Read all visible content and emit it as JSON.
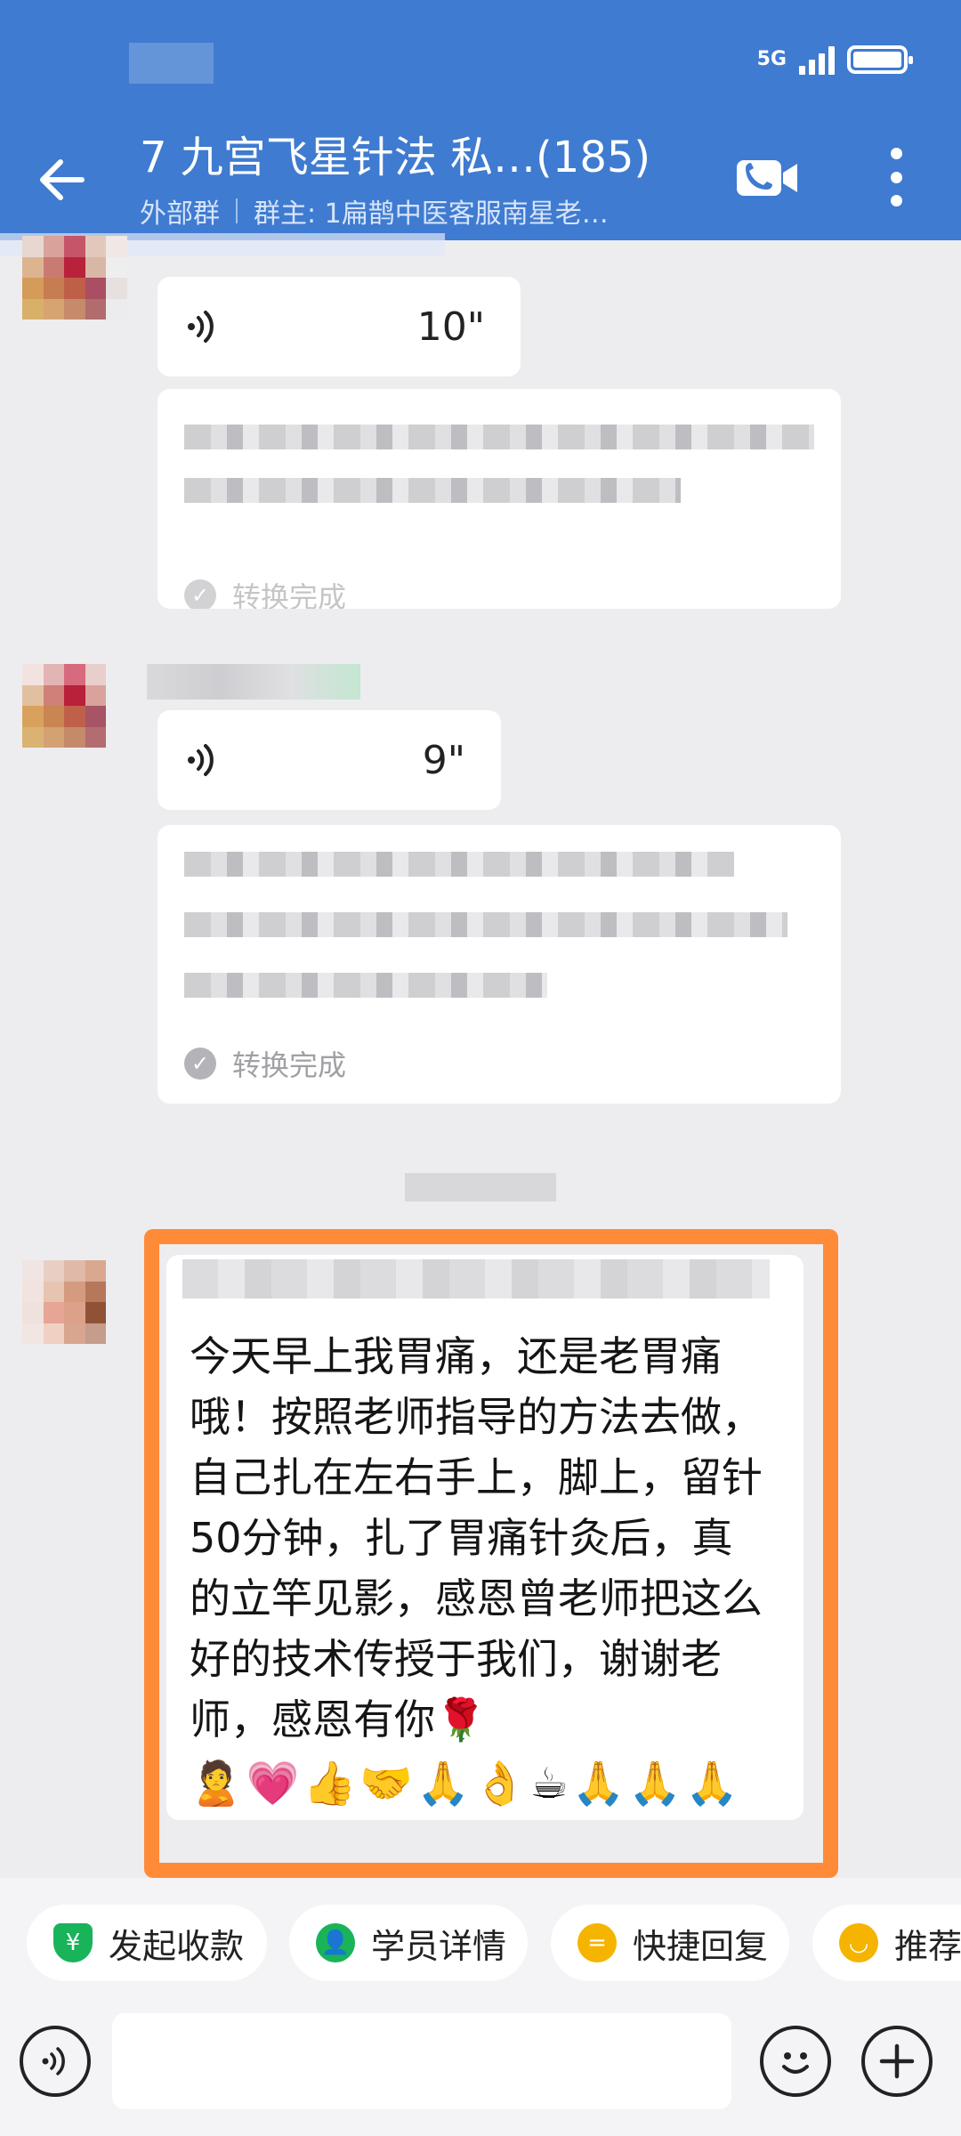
{
  "status_bar": {
    "signal": "5G"
  },
  "header": {
    "title": "7  九宫飞星针法 私…(185)",
    "group_type": "外部群",
    "owner": "群主: 1扁鹊中医客服南星老…"
  },
  "messages": [
    {
      "type": "voice",
      "duration": "10\"",
      "transcription_status": "转换完成"
    },
    {
      "type": "voice",
      "duration": "9\"",
      "transcription_status": "转换完成"
    },
    {
      "type": "text",
      "text": "今天早上我胃痛，还是老胃痛哦！按照老师指导的方法去做，自己扎在左右手上，脚上，留针50分钟，扎了胃痛针灸后，真的立竿见影，感恩曾老师把这么好的技术传授于我们，谢谢老师，感恩有你🌹",
      "emojis": "🙎💗👍🤝🙏👌☕🙏🙏🙏"
    }
  ],
  "quick_actions": [
    {
      "label": "发起收款",
      "icon": "yuan-shield-icon",
      "color": "#19b35a"
    },
    {
      "label": "学员详情",
      "icon": "person-list-icon",
      "color": "#19b35a"
    },
    {
      "label": "快捷回复",
      "icon": "quick-reply-icon",
      "color": "#f5b400"
    },
    {
      "label": "推荐",
      "icon": "recommend-icon",
      "color": "#f5b400"
    }
  ],
  "input": {
    "placeholder": ""
  },
  "colors": {
    "header": "#3f7bd0",
    "highlight": "#ff8a38"
  }
}
